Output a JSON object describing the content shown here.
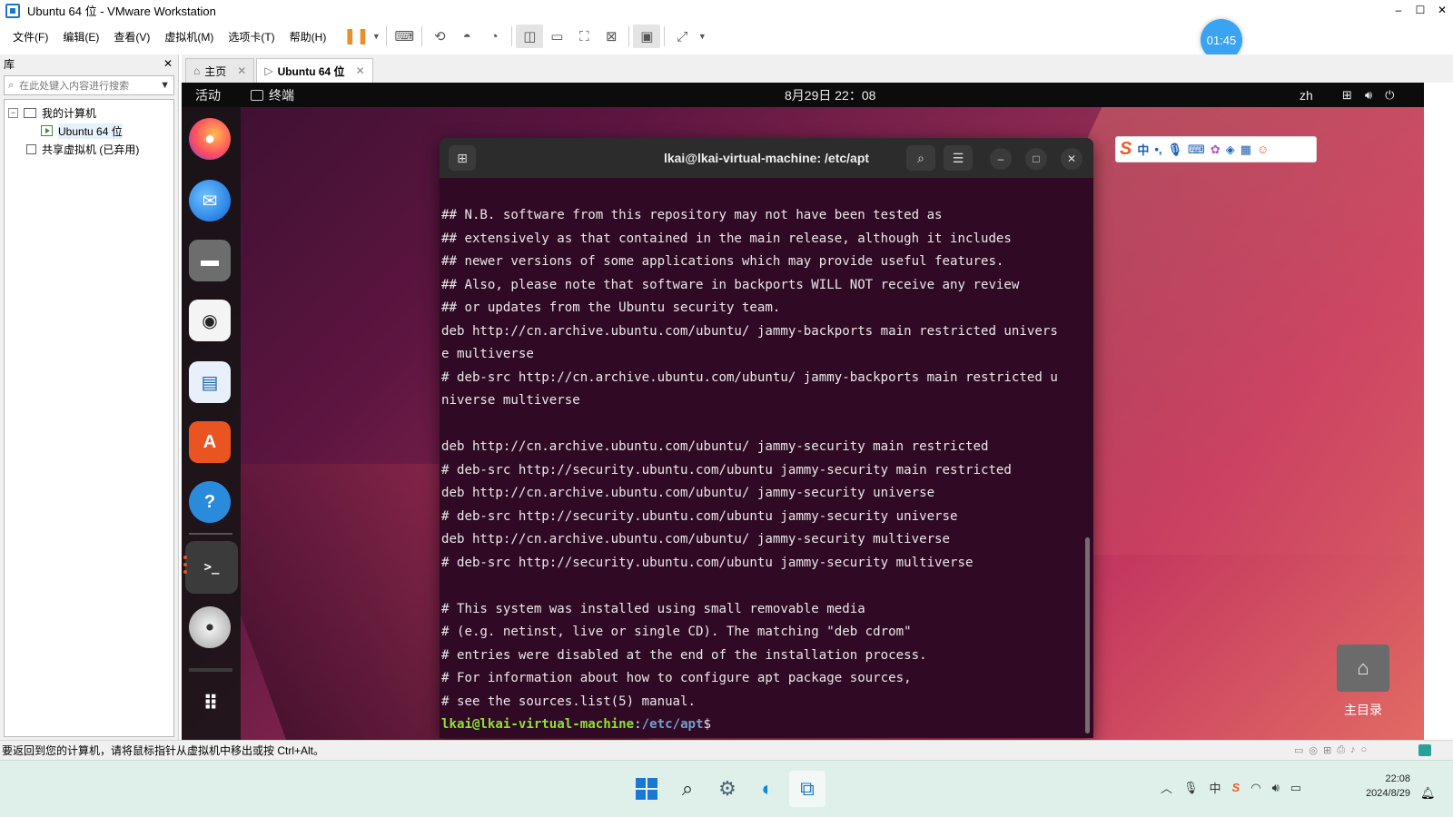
{
  "window": {
    "title": "Ubuntu 64 位 - VMware Workstation"
  },
  "menu": [
    "文件(F)",
    "编辑(E)",
    "查看(V)",
    "虚拟机(M)",
    "选项卡(T)",
    "帮助(H)"
  ],
  "timer": "01:45",
  "library": {
    "title": "库",
    "search_placeholder": "在此处键入内容进行搜索",
    "tree": [
      {
        "label": "我的计算机"
      },
      {
        "label": "Ubuntu 64 位"
      },
      {
        "label": "共享虚拟机 (已弃用)"
      }
    ]
  },
  "tabs": [
    {
      "label": "主页"
    },
    {
      "label": "Ubuntu 64 位"
    }
  ],
  "ubuntu": {
    "activities": "活动",
    "app_label": "终端",
    "datetime": "8月29日 22：08",
    "lang": "zh",
    "home_folder": "主目录"
  },
  "terminal": {
    "title": "lkai@lkai-virtual-machine: /etc/apt",
    "lines": [
      "## N.B. software from this repository may not have been tested as",
      "## extensively as that contained in the main release, although it includes",
      "## newer versions of some applications which may provide useful features.",
      "## Also, please note that software in backports WILL NOT receive any review",
      "## or updates from the Ubuntu security team.",
      "deb http://cn.archive.ubuntu.com/ubuntu/ jammy-backports main restricted univers",
      "e multiverse",
      "# deb-src http://cn.archive.ubuntu.com/ubuntu/ jammy-backports main restricted u",
      "niverse multiverse",
      "",
      "deb http://cn.archive.ubuntu.com/ubuntu/ jammy-security main restricted",
      "# deb-src http://security.ubuntu.com/ubuntu jammy-security main restricted",
      "deb http://cn.archive.ubuntu.com/ubuntu/ jammy-security universe",
      "# deb-src http://security.ubuntu.com/ubuntu jammy-security universe",
      "deb http://cn.archive.ubuntu.com/ubuntu/ jammy-security multiverse",
      "# deb-src http://security.ubuntu.com/ubuntu jammy-security multiverse",
      "",
      "# This system was installed using small removable media",
      "# (e.g. netinst, live or single CD). The matching \"deb cdrom\"",
      "# entries were disabled at the end of the installation process.",
      "# For information about how to configure apt package sources,",
      "# see the sources.list(5) manual."
    ],
    "prompt_user": "lkai@lkai-virtual-machine",
    "prompt_sep": ":",
    "prompt_path": "/etc/apt",
    "prompt_end": "$"
  },
  "status": {
    "text": "要返回到您的计算机，请将鼠标指针从虚拟机中移出或按 Ctrl+Alt。"
  },
  "taskbar": {
    "time": "22:08",
    "date": "2024/8/29"
  },
  "colors": {
    "ubuntu_orange": "#e95420",
    "terminal_bg": "#300a24",
    "prompt_green": "#8ae234",
    "prompt_blue": "#729fcf"
  }
}
